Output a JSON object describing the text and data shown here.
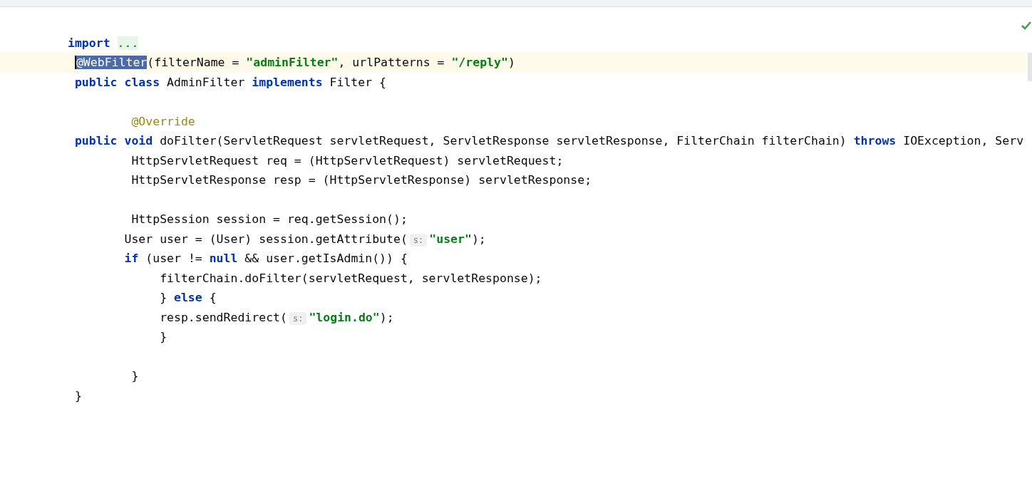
{
  "editor": {
    "inspection_ok": true,
    "lines": [
      {
        "current": false
      },
      {
        "current": false,
        "kind": "import",
        "tokens": [
          {
            "kind": "keyword",
            "text": "import"
          },
          {
            "kind": "fold",
            "text": "..."
          }
        ]
      },
      {
        "current": true,
        "kind": "declaration",
        "tokens": [
          {
            "kind": "selected",
            "text": "@WebFilter"
          },
          {
            "kind": "plain",
            "text": "(filterName = "
          },
          {
            "kind": "string",
            "text": "\"adminFilter\""
          },
          {
            "kind": "plain",
            "text": ", urlPatterns = "
          },
          {
            "kind": "string",
            "text": "\"/reply\""
          },
          {
            "kind": "plain",
            "text": ")"
          }
        ]
      },
      {
        "current": false,
        "kind": "declaration",
        "tokens": [
          {
            "kind": "keyword",
            "text": "public class"
          },
          {
            "kind": "plain",
            "text": " AdminFilter "
          },
          {
            "kind": "keyword",
            "text": "implements"
          },
          {
            "kind": "plain",
            "text": " Filter {"
          }
        ]
      },
      {
        "current": false
      },
      {
        "current": false,
        "kind": "member",
        "tokens": [
          {
            "kind": "annotation",
            "text": "@Override"
          }
        ]
      },
      {
        "current": false,
        "kind": "declaration",
        "tokens": [
          {
            "kind": "keyword",
            "text": "public void"
          },
          {
            "kind": "plain",
            "text": " doFilter(ServletRequest servletRequest, ServletResponse servletResponse, FilterChain filterChain) "
          },
          {
            "kind": "keyword",
            "text": "throws"
          },
          {
            "kind": "plain",
            "text": " IOException, Serv"
          }
        ]
      },
      {
        "current": false,
        "kind": "member",
        "tokens": [
          {
            "kind": "plain",
            "text": "HttpServletRequest req = (HttpServletRequest) servletRequest;"
          }
        ]
      },
      {
        "current": false,
        "kind": "member",
        "tokens": [
          {
            "kind": "plain",
            "text": "HttpServletResponse resp = (HttpServletResponse) servletResponse;"
          }
        ]
      },
      {
        "current": false
      },
      {
        "current": false,
        "kind": "member",
        "tokens": [
          {
            "kind": "plain",
            "text": "HttpSession session = req.getSession();"
          }
        ]
      },
      {
        "current": false,
        "kind": "statement",
        "tokens": [
          {
            "kind": "plain",
            "text": "User user = (User) session.getAttribute("
          },
          {
            "kind": "hint",
            "text": "s:"
          },
          {
            "kind": "string",
            "text": "\"user\""
          },
          {
            "kind": "plain",
            "text": ");"
          }
        ]
      },
      {
        "current": false,
        "kind": "statement",
        "tokens": [
          {
            "kind": "keyword",
            "text": "if"
          },
          {
            "kind": "plain",
            "text": " (user != "
          },
          {
            "kind": "keyword",
            "text": "null"
          },
          {
            "kind": "plain",
            "text": " && user.getIsAdmin()) {"
          }
        ]
      },
      {
        "current": false,
        "kind": "block",
        "tokens": [
          {
            "kind": "plain",
            "text": "filterChain.doFilter(servletRequest, servletResponse);"
          }
        ]
      },
      {
        "current": false,
        "kind": "block",
        "tokens": [
          {
            "kind": "plain",
            "text": "} "
          },
          {
            "kind": "keyword",
            "text": "else"
          },
          {
            "kind": "plain",
            "text": " {"
          }
        ]
      },
      {
        "current": false,
        "kind": "block",
        "tokens": [
          {
            "kind": "plain",
            "text": "resp.sendRedirect("
          },
          {
            "kind": "hint",
            "text": "s:"
          },
          {
            "kind": "string",
            "text": "\"login.do\""
          },
          {
            "kind": "plain",
            "text": ");"
          }
        ]
      },
      {
        "current": false,
        "kind": "block",
        "tokens": [
          {
            "kind": "plain",
            "text": "}"
          }
        ]
      },
      {
        "current": false
      },
      {
        "current": false,
        "kind": "member",
        "tokens": [
          {
            "kind": "plain",
            "text": "}"
          }
        ]
      },
      {
        "current": false,
        "kind": "declaration",
        "tokens": [
          {
            "kind": "plain",
            "text": "}"
          }
        ]
      }
    ]
  }
}
